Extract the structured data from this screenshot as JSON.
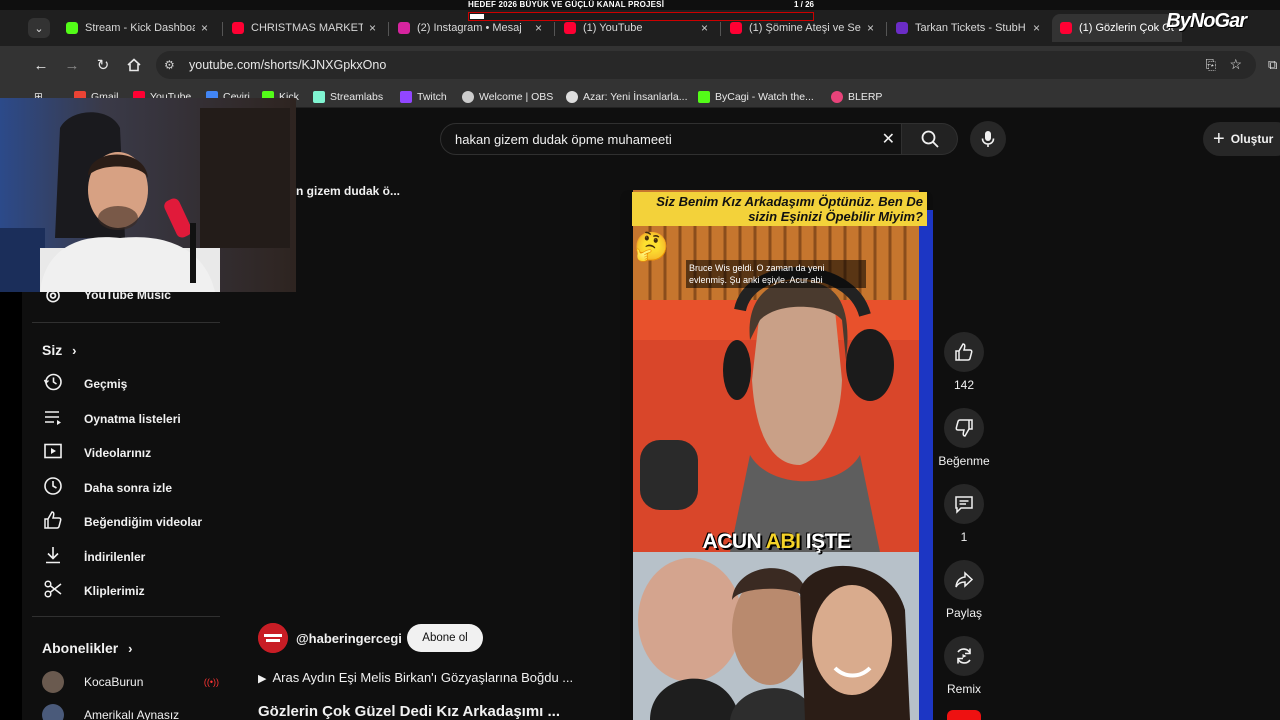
{
  "overlay": {
    "title": "HEDEF 2026 BÜYÜK VE GÜÇLÜ KANAL PROJESİ",
    "count": "1 / 26",
    "progress_fraction": 0.04
  },
  "watermark": "ByNoGar",
  "tabs": [
    {
      "label": "Stream - Kick Dashboa",
      "icon": "kick-icon",
      "color": "#53fc18",
      "close": "×"
    },
    {
      "label": "CHRISTMAS MARKET",
      "icon": "youtube-icon",
      "color": "#ff0033",
      "close": "×"
    },
    {
      "label": "(2) Instagram • Mesaj",
      "icon": "instagram-icon",
      "color": "#d6249f",
      "close": "×"
    },
    {
      "label": "(1) YouTube",
      "icon": "youtube-icon",
      "color": "#ff0033",
      "close": "×"
    },
    {
      "label": "(1) Şömine Ateşi ve Se",
      "icon": "youtube-icon",
      "color": "#ff0033",
      "close": "×"
    },
    {
      "label": "Tarkan Tickets - StubH",
      "icon": "stubhub-icon",
      "color": "#6b2cc6",
      "close": "×"
    },
    {
      "label": "(1) Gözlerin Çok Gü",
      "icon": "youtube-icon",
      "color": "#ff0033",
      "close": "×"
    }
  ],
  "address": {
    "url": "youtube.com/shorts/KJNXGpkxOno"
  },
  "bookmarks": [
    {
      "label": "Gmail",
      "icon": "gmail-icon",
      "color": "#ea4335"
    },
    {
      "label": "YouTube",
      "icon": "youtube-icon",
      "color": "#ff0033"
    },
    {
      "label": "Çeviri",
      "icon": "translate-icon",
      "color": "#4285f4"
    },
    {
      "label": "Kick",
      "icon": "kick-icon",
      "color": "#53fc18"
    },
    {
      "label": "Streamlabs",
      "icon": "streamlabs-icon",
      "color": "#80f5d2"
    },
    {
      "label": "Twitch",
      "icon": "twitch-icon",
      "color": "#9146ff"
    },
    {
      "label": "Welcome | OBS",
      "icon": "obs-icon",
      "color": "#cccccc"
    },
    {
      "label": "Azar: Yeni İnsanlarla...",
      "icon": "azar-icon",
      "color": "#dddddd"
    },
    {
      "label": "ByCagi - Watch the...",
      "icon": "kick-icon",
      "color": "#53fc18"
    },
    {
      "label": "BLERP",
      "icon": "blerp-icon",
      "color": "#e8437a"
    }
  ],
  "search": {
    "query": "hakan gizem dudak öpme muhameeti"
  },
  "create_label": "Oluştur",
  "shorts_crumb": "n gizem dudak ö...",
  "sidebar": {
    "music_label": "YouTube Music",
    "siz_label": "Siz",
    "items": [
      {
        "label": "Geçmiş",
        "icon": "history-icon"
      },
      {
        "label": "Oynatma listeleri",
        "icon": "playlist-icon"
      },
      {
        "label": "Videolarınız",
        "icon": "your-videos-icon"
      },
      {
        "label": "Daha sonra izle",
        "icon": "watch-later-icon"
      },
      {
        "label": "Beğendiğim videolar",
        "icon": "liked-icon"
      },
      {
        "label": "İndirilenler",
        "icon": "download-icon"
      },
      {
        "label": "Kliplerimiz",
        "icon": "clips-icon"
      }
    ],
    "subs_label": "Abonelikler",
    "subscriptions": [
      {
        "label": "KocaBurun",
        "live": true
      },
      {
        "label": "Amerikalı Aynasız",
        "live": false
      }
    ]
  },
  "video": {
    "caption": "Siz Benim Kız Arkadaşımı Öptünüz. Ben De sizin Eşinizi Öpebilir Miyim?",
    "subtitle": "Bruce Wis geldi. O zaman da yeni evlenmiş. Şu anki eşiyle. Acur abi",
    "overlay_pre": "ACUN ",
    "overlay_hl": "ABI",
    "overlay_post": " IŞTE"
  },
  "actions": {
    "like_count": "142",
    "dislike_label": "Beğenme",
    "comment_count": "1",
    "share_label": "Paylaş",
    "remix_label": "Remix"
  },
  "channel": {
    "handle": "@haberingercegi",
    "subscribe_label": "Abone ol",
    "music": "Aras Aydın Eşi Melis Birkan'ı Gözyaşlarına Boğdu ...",
    "title": "Gözlerin Çok Güzel Dedi Kız Arkadaşımı ..."
  }
}
